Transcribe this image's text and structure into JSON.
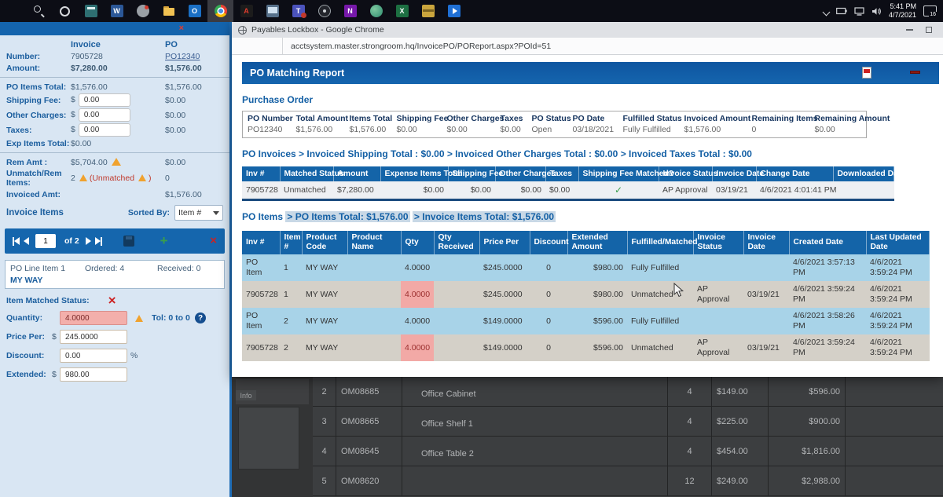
{
  "taskbar": {
    "time": "5:41 PM",
    "date": "4/7/2021",
    "notification_count": "16",
    "icons": [
      "start",
      "search",
      "cortana",
      "calculator",
      "word",
      "satellite",
      "file-explorer",
      "outlook",
      "chrome",
      "acrobat",
      "remote-pc",
      "teams",
      "record",
      "onenote",
      "globe",
      "excel",
      "archive",
      "movies"
    ]
  },
  "icons": {
    "close_x": "×",
    "check": "✓",
    "plus": "+",
    "question": "?",
    "word_glyph": "W",
    "outlook_glyph": "O",
    "acrobat_glyph": "A",
    "teams_glyph": "T",
    "onenote_glyph": "N",
    "excel_glyph": "X"
  },
  "colors": {
    "accent_blue": "#1464a8",
    "row_blue": "#a8d3e8",
    "row_gray": "#d4d0c8",
    "alert_pink": "#f2a9a6",
    "warning_orange": "#f0a22e",
    "success_green": "#3a9e4c",
    "error_red": "#cc2222"
  },
  "panel": {
    "currency": "$",
    "summary": {
      "invoice_col": "Invoice",
      "po_col": "PO",
      "number_label": "Number:",
      "invoice_number": "7905728",
      "po_number": "PO12340",
      "amount_label": "Amount:",
      "invoice_amount": "$7,280.00",
      "po_amount": "$1,576.00"
    },
    "totals": {
      "po_items_total_label": "PO Items Total:",
      "po_items_total_invoice": "$1,576.00",
      "po_items_total_po": "$1,576.00",
      "shipping_fee_label": "Shipping Fee:",
      "shipping_fee_value": "0.00",
      "shipping_fee_po": "$0.00",
      "other_charges_label": "Other Charges:",
      "other_charges_value": "0.00",
      "other_charges_po": "$0.00",
      "taxes_label": "Taxes:",
      "taxes_value": "0.00",
      "taxes_po": "$0.00",
      "exp_items_total_label": "Exp Items Total:",
      "exp_items_total_value": "$0.00"
    },
    "remaining": {
      "rem_amt_label": "Rem Amt :",
      "rem_amt_invoice": "$5,704.00",
      "rem_amt_po": "$0.00",
      "unmatch_label": "Unmatch/Rem Items:",
      "unmatch_invoice": "2",
      "unmatch_note_open": "(Unmatched",
      "unmatch_note_close": ")",
      "unmatch_po": "0",
      "invoiced_amt_label": "Invoiced Amt:",
      "invoiced_amt_po": "$1,576.00"
    },
    "invoice_items": {
      "title": "Invoice Items",
      "sorted_by_label": "Sorted By:",
      "sort_value": "Item #",
      "page_value": "1",
      "page_of": "of 2"
    },
    "line_item": {
      "title": "PO Line Item 1",
      "ordered": "Ordered: 4",
      "received": "Received: 0",
      "product": "MY WAY",
      "matched_status_label": "Item Matched Status:",
      "quantity_label": "Quantity:",
      "quantity_value": "4.0000",
      "tolerance": "Tol: 0 to 0",
      "price_per_label": "Price Per:",
      "price_per_value": "245.0000",
      "discount_label": "Discount:",
      "discount_value": "0.00",
      "percent": "%",
      "extended_label": "Extended:",
      "extended_value": "980.00"
    }
  },
  "chrome": {
    "window_title": "Payables Lockbox - Google Chrome",
    "url": "acctsystem.master.strongroom.hq/InvoicePO/POReport.aspx?POId=51"
  },
  "report": {
    "title": "PO Matching Report",
    "purchase_order": {
      "heading": "Purchase Order",
      "headers": [
        "PO Number",
        "Total Amount",
        "Items Total",
        "Shipping Fee",
        "Other Charges",
        "Taxes",
        "PO Status",
        "PO Date",
        "Fulfilled Status",
        "Invoiced Amount",
        "Remaining Items",
        "Remaining Amount"
      ],
      "row": [
        "PO12340",
        "$1,576.00",
        "$1,576.00",
        "$0.00",
        "$0.00",
        "$0.00",
        "Open",
        "03/18/2021",
        "Fully Fulfilled",
        "$1,576.00",
        "0",
        "$0.00"
      ]
    },
    "po_invoices": {
      "heading": "PO Invoices > Invoiced Shipping Total : $0.00 > Invoiced Other Charges Total : $0.00 > Invoiced Taxes Total : $0.00",
      "headers": [
        "Inv #",
        "Matched Status",
        "Amount",
        "Expense Items Total",
        "Shipping Fee",
        "Other Charges",
        "Taxes",
        "Shipping Fee Matched?",
        "Invoice Status",
        "Invoice Date",
        "Change Date",
        "Downloaded Date"
      ],
      "row": {
        "inv": "7905728",
        "matched": "Unmatched",
        "amount": "$7,280.00",
        "expense": "$0.00",
        "shipping": "$0.00",
        "other": "$0.00",
        "taxes": "$0.00",
        "status": "AP Approval",
        "inv_date": "03/19/21",
        "change_date": "4/6/2021 4:01:41 PM",
        "downloaded": ""
      }
    },
    "po_items": {
      "heading_prefix": "PO Items",
      "heading_hl1": "> PO Items Total: $1,576.00",
      "heading_hl2": "> Invoice Items Total: $1,576.00",
      "headers": [
        "Inv #",
        "Item #",
        "Product Code",
        "Product Name",
        "Qty",
        "Qty Received",
        "Price Per",
        "Discount",
        "Extended Amount",
        "Fulfilled/Matched",
        "Invoice Status",
        "Invoice Date",
        "Created Date",
        "Last Updated Date"
      ],
      "rows": [
        {
          "inv": "PO Item",
          "item": "1",
          "code": "MY WAY",
          "name": "",
          "qty": "4.0000",
          "qty_received": "",
          "price": "$245.0000",
          "discount": "0",
          "ext": "$980.00",
          "fulfilled": "Fully Fulfilled",
          "status": "",
          "inv_date": "",
          "created": "4/6/2021 3:57:13 PM",
          "updated": "4/6/2021 3:59:24 PM"
        },
        {
          "inv": "7905728",
          "item": "1",
          "code": "MY WAY",
          "name": "",
          "qty": "4.0000",
          "qty_received": "",
          "price": "$245.0000",
          "discount": "0",
          "ext": "$980.00",
          "fulfilled": "Unmatched",
          "status": "AP Approval",
          "inv_date": "03/19/21",
          "created": "4/6/2021 3:59:24 PM",
          "updated": "4/6/2021 3:59:24 PM"
        },
        {
          "inv": "PO Item",
          "item": "2",
          "code": "MY WAY",
          "name": "",
          "qty": "4.0000",
          "qty_received": "",
          "price": "$149.0000",
          "discount": "0",
          "ext": "$596.00",
          "fulfilled": "Fully Fulfilled",
          "status": "",
          "inv_date": "",
          "created": "4/6/2021 3:58:26 PM",
          "updated": "4/6/2021 3:59:24 PM"
        },
        {
          "inv": "7905728",
          "item": "2",
          "code": "MY WAY",
          "name": "",
          "qty": "4.0000",
          "qty_received": "",
          "price": "$149.0000",
          "discount": "0",
          "ext": "$596.00",
          "fulfilled": "Unmatched",
          "status": "AP Approval",
          "inv_date": "03/19/21",
          "created": "4/6/2021 3:59:24 PM",
          "updated": "4/6/2021 3:59:24 PM"
        }
      ]
    }
  },
  "background": {
    "info_tab": "Info",
    "rows": [
      {
        "num": "2",
        "code": "OM08685",
        "name": "Office Cabinet",
        "qty": "4",
        "price": "$149.00",
        "ext": "$596.00"
      },
      {
        "num": "3",
        "code": "OM08665",
        "name": "Office Shelf 1",
        "qty": "4",
        "price": "$225.00",
        "ext": "$900.00"
      },
      {
        "num": "4",
        "code": "OM08645",
        "name": "Office Table 2",
        "qty": "4",
        "price": "$454.00",
        "ext": "$1,816.00"
      },
      {
        "num": "5",
        "code": "OM08620",
        "name": "",
        "qty": "12",
        "price": "$249.00",
        "ext": "$2,988.00"
      }
    ]
  }
}
